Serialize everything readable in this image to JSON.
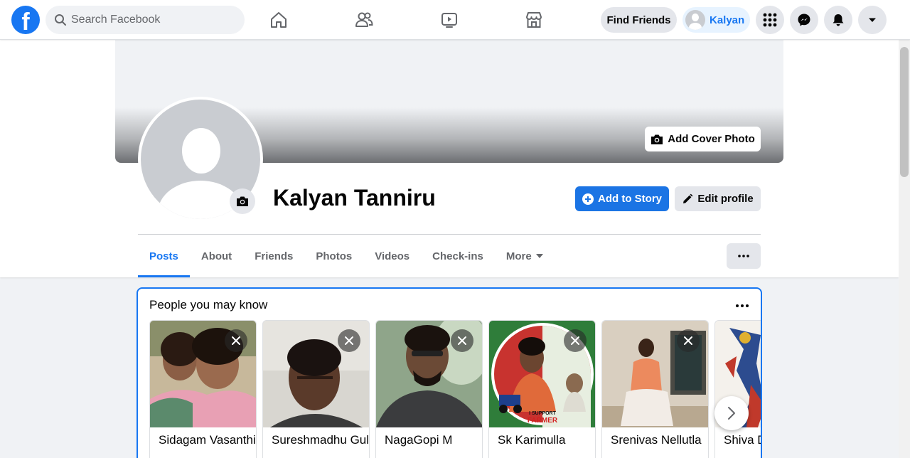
{
  "topbar": {
    "logo": "f",
    "search_placeholder": "Search Facebook",
    "nav_icons": [
      "home-icon",
      "friends-icon",
      "watch-icon",
      "marketplace-icon"
    ],
    "find_friends": "Find Friends",
    "user_name": "Kalyan",
    "right_icons": [
      "menu-grid-icon",
      "messenger-icon",
      "notifications-icon",
      "account-caret-icon"
    ]
  },
  "profile": {
    "add_cover_photo": "Add Cover Photo",
    "name": "Kalyan Tanniru",
    "add_to_story": "Add to Story",
    "edit_profile": "Edit profile",
    "tabs": [
      "Posts",
      "About",
      "Friends",
      "Photos",
      "Videos",
      "Check-ins",
      "More"
    ],
    "active_tab": "Posts"
  },
  "pymk": {
    "title": "People you may know",
    "people": [
      {
        "name": "Sidagam Vasanthi"
      },
      {
        "name": "Sureshmadhu Gulla"
      },
      {
        "name": "NagaGopi M"
      },
      {
        "name": "Sk Karimulla",
        "badge_line1": "I SUPPORT",
        "badge_line2": "FARMER"
      },
      {
        "name": "Srenivas Nellutla"
      },
      {
        "name": "Shiva D"
      }
    ]
  },
  "colors": {
    "brand": "#1877f2",
    "button_gray": "#e4e6eb",
    "page_bg": "#f0f2f5"
  }
}
